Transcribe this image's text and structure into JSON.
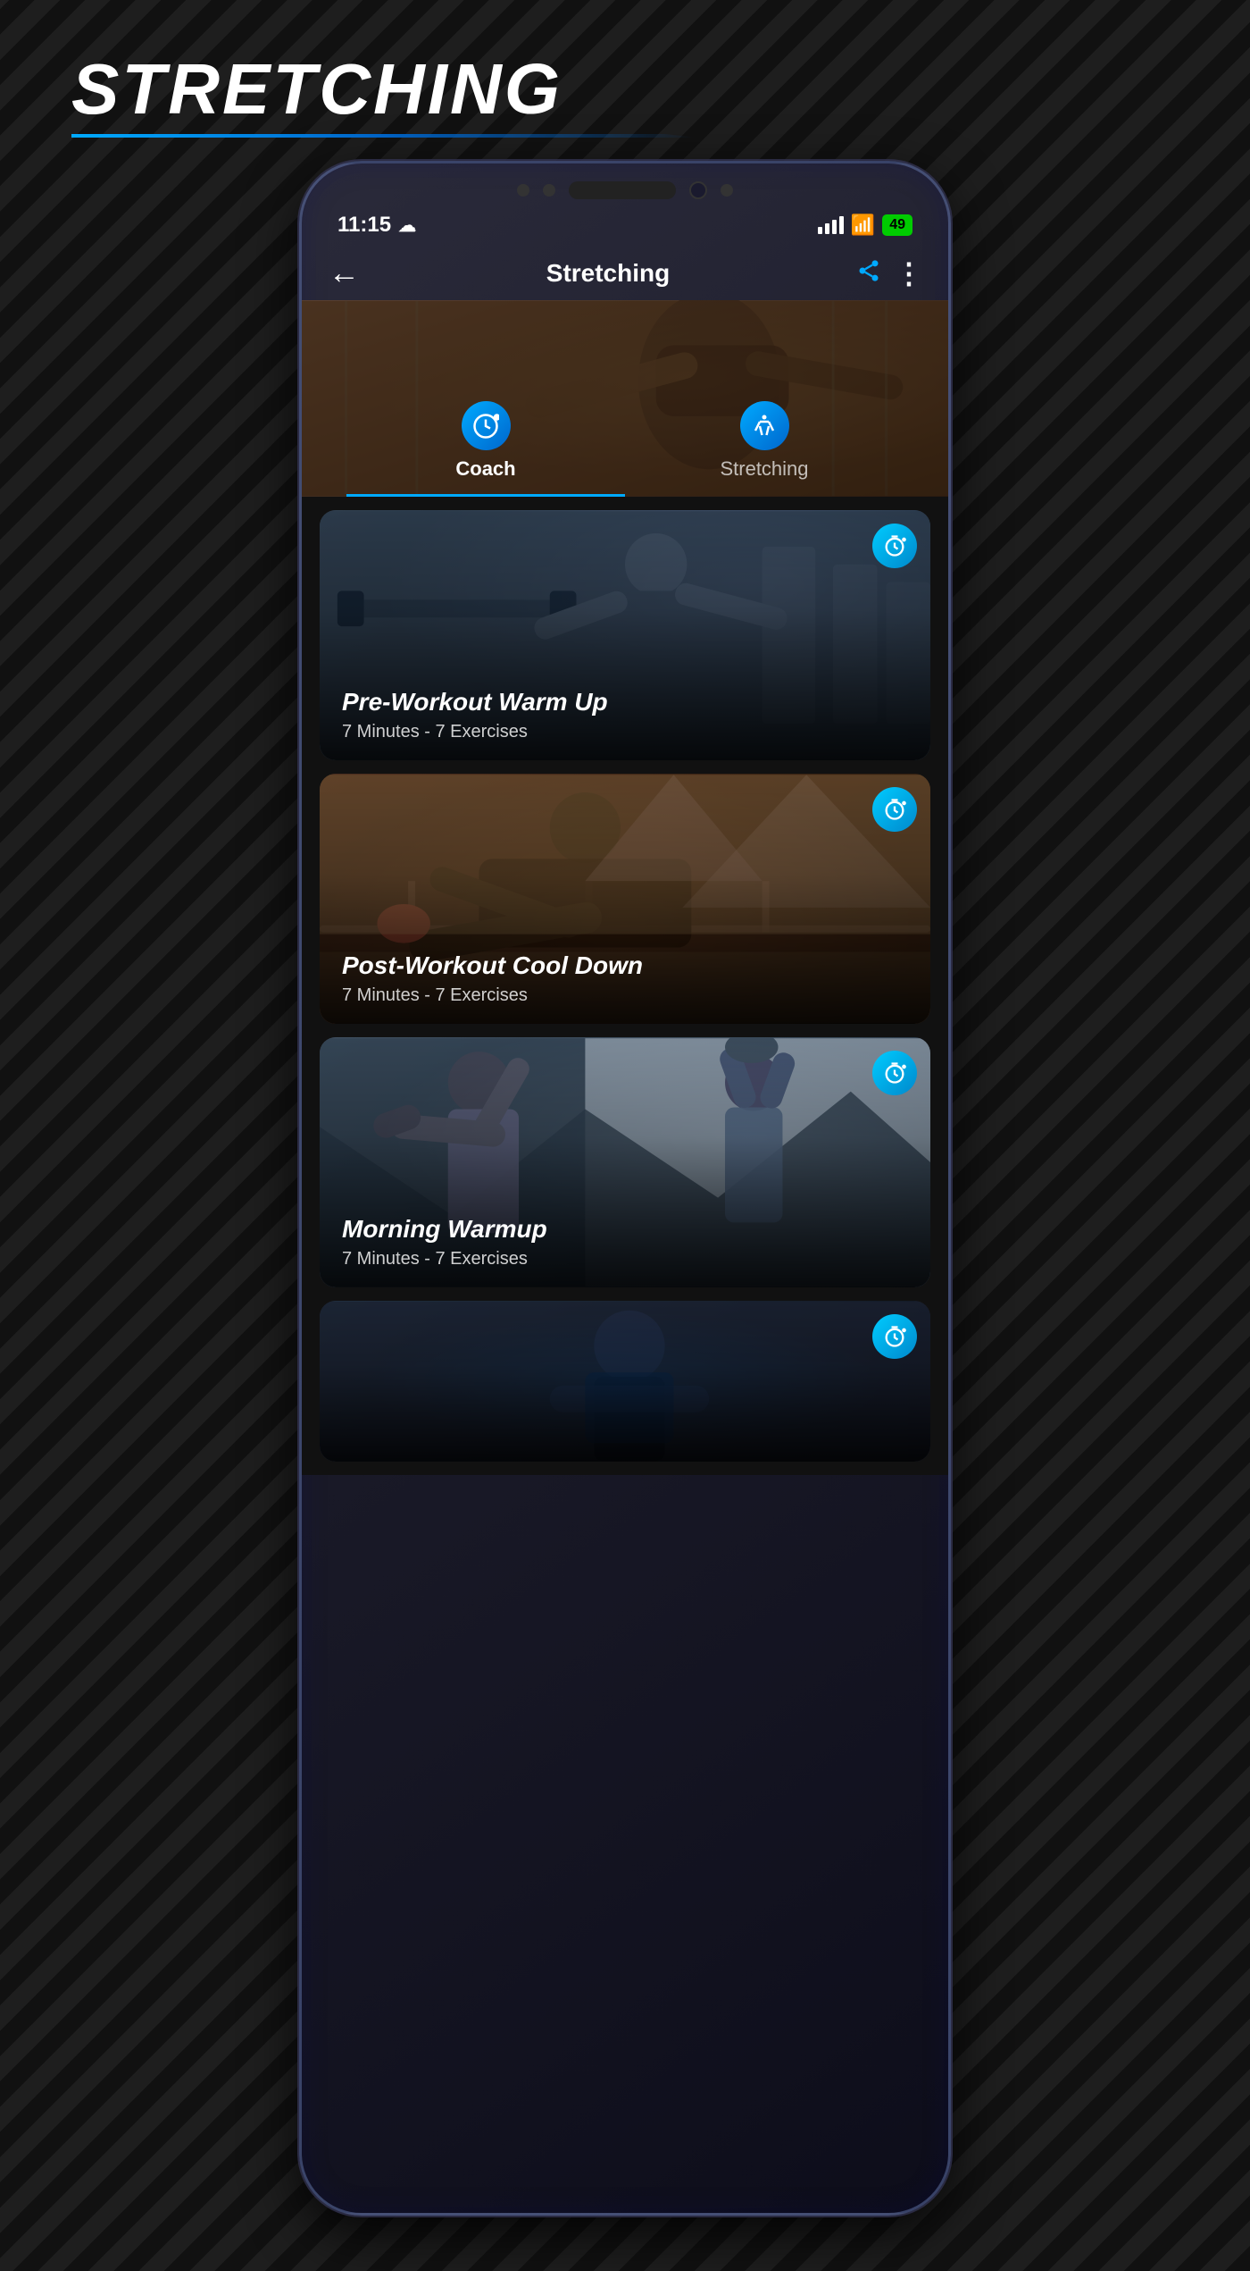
{
  "page": {
    "title": "STRETCHING",
    "background_color": "#1a1a1a"
  },
  "status_bar": {
    "time": "11:15",
    "battery": "49",
    "battery_color": "#00cc00"
  },
  "app_bar": {
    "title": "Stretching",
    "back_icon": "←",
    "share_icon": "⋙",
    "more_icon": "⋮"
  },
  "tabs": [
    {
      "id": "coach",
      "label": "Coach",
      "icon": "⏱",
      "active": true
    },
    {
      "id": "stretching",
      "label": "Stretching",
      "icon": "💪",
      "active": false
    }
  ],
  "workout_cards": [
    {
      "id": "pre-workout",
      "title": "Pre-Workout Warm Up",
      "subtitle": "7 Minutes - 7 Exercises",
      "timer_icon": "⏱"
    },
    {
      "id": "post-workout",
      "title": "Post-Workout Cool Down",
      "subtitle": "7 Minutes - 7 Exercises",
      "timer_icon": "⏱"
    },
    {
      "id": "morning-warmup",
      "title": "Morning Warmup",
      "subtitle": "7 Minutes - 7 Exercises",
      "timer_icon": "⏱"
    },
    {
      "id": "card-4",
      "title": "",
      "subtitle": "",
      "timer_icon": "⏱"
    }
  ]
}
